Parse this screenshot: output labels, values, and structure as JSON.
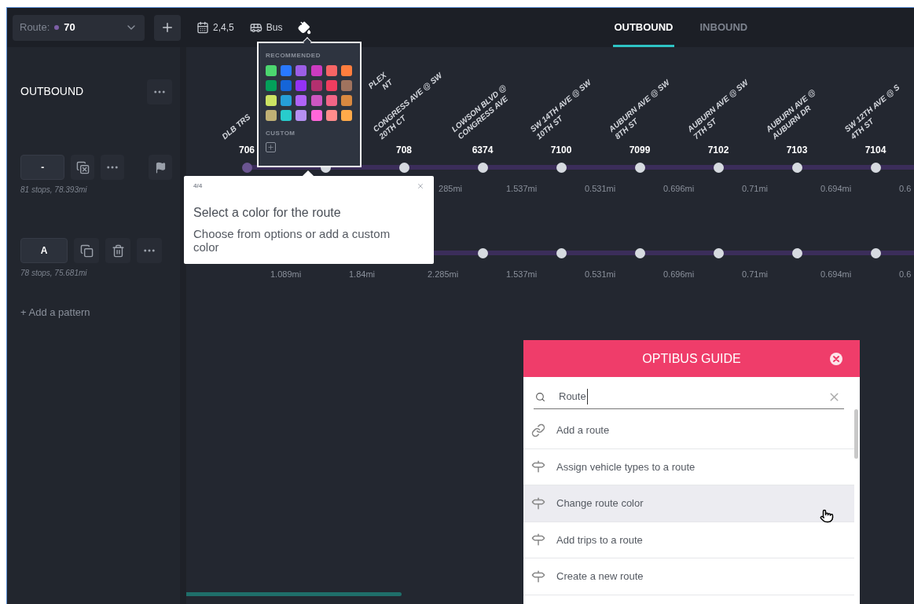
{
  "toolbar": {
    "route_select": {
      "label": "Route:",
      "value": "70",
      "color": "#7d5fa6"
    },
    "days": "2,4,5",
    "vehicle": "Bus"
  },
  "tabs": [
    {
      "label": "OUTBOUND",
      "selected": true
    },
    {
      "label": "INBOUND",
      "selected": false
    }
  ],
  "sidebar": {
    "title": "OUTBOUND",
    "patterns": [
      {
        "name": "-",
        "summary": "81 stops, 78.393mi",
        "kind": "main"
      },
      {
        "name": "A",
        "summary": "78 stops, 75.681mi",
        "kind": "variant"
      }
    ],
    "add_link": "+ Add a pattern"
  },
  "stops": [
    {
      "name_lines": [
        "DLB TRS"
      ],
      "code": "706",
      "kind": "full"
    },
    {
      "name_lines": [
        "PLEX",
        "NT"
      ],
      "kind": "cut"
    },
    {
      "name_lines": [
        "CONGRESS AVE @ SW",
        "20TH CT"
      ],
      "code": "708",
      "kind": "full"
    },
    {
      "name_lines": [
        "LOWSON BLVD @",
        "CONGRESS AVE"
      ],
      "code": "6374",
      "kind": "full"
    },
    {
      "name_lines": [
        "SW 14TH AVE @ SW",
        "10TH ST"
      ],
      "code": "7100",
      "kind": "full"
    },
    {
      "name_lines": [
        "AUBURN AVE @ SW",
        "8TH ST"
      ],
      "code": "7099",
      "kind": "full"
    },
    {
      "name_lines": [
        "AUBURN AVE @ SW",
        "7TH ST"
      ],
      "code": "7102",
      "kind": "full"
    },
    {
      "name_lines": [
        "AUBURN AVE @",
        "AUBURN DR"
      ],
      "code": "7103",
      "kind": "full"
    },
    {
      "name_lines": [
        "SW 12TH AVE @ S",
        "4TH ST"
      ],
      "code": "7104",
      "kind": "full"
    }
  ],
  "pattern_rows": [
    {
      "dots": [
        {
          "kind": "first"
        },
        {
          "kind": "stop"
        },
        {
          "kind": "stop"
        },
        {
          "kind": "stop"
        },
        {
          "kind": "stop"
        },
        {
          "kind": "stop"
        },
        {
          "kind": "stop"
        },
        {
          "kind": "stop"
        },
        {
          "kind": "stop"
        }
      ],
      "segments": [
        {
          "kind": "covered"
        },
        {
          "kind": "covered"
        },
        {
          "kind": "cut",
          "text": "285mi"
        },
        {
          "kind": "full",
          "text": "1.537mi"
        },
        {
          "kind": "full",
          "text": "0.531mi"
        },
        {
          "kind": "full",
          "text": "0.696mi"
        },
        {
          "kind": "full",
          "text": "0.71mi"
        },
        {
          "kind": "full",
          "text": "0.694mi"
        },
        {
          "kind": "full",
          "text": "0.6"
        }
      ]
    },
    {
      "dots": [
        {
          "kind": "covered"
        },
        {
          "kind": "covered"
        },
        {
          "kind": "covered"
        },
        {
          "kind": "stop"
        },
        {
          "kind": "stop"
        },
        {
          "kind": "stop"
        },
        {
          "kind": "stop"
        },
        {
          "kind": "stop"
        },
        {
          "kind": "stop"
        }
      ],
      "segments": [
        {
          "kind": "full",
          "text": "1.089mi"
        },
        {
          "kind": "full",
          "text": "1.84mi"
        },
        {
          "kind": "full",
          "text": "2.285mi"
        },
        {
          "kind": "full",
          "text": "1.537mi"
        },
        {
          "kind": "full",
          "text": "0.531mi"
        },
        {
          "kind": "full",
          "text": "0.696mi"
        },
        {
          "kind": "full",
          "text": "0.71mi"
        },
        {
          "kind": "full",
          "text": "0.694mi"
        },
        {
          "kind": "full",
          "text": "0.6"
        }
      ]
    }
  ],
  "color_popover": {
    "recommended_title": "RECOMMENDED",
    "swatches": [
      {
        "color": "#4cd66f"
      },
      {
        "color": "#2979ff"
      },
      {
        "color": "#9c5ee6"
      },
      {
        "color": "#cc3bc0"
      },
      {
        "color": "#f76565"
      },
      {
        "color": "#ff7e3e"
      },
      {
        "color": "#03a05a"
      },
      {
        "color": "#1565d8"
      },
      {
        "color": "#9432f5"
      },
      {
        "color": "#b3306f"
      },
      {
        "color": "#ef3d5f"
      },
      {
        "color": "#a0735e"
      },
      {
        "color": "#cde363"
      },
      {
        "color": "#269fd9"
      },
      {
        "color": "#b063f7"
      },
      {
        "color": "#cc56c1"
      },
      {
        "color": "#f26587"
      },
      {
        "color": "#d98940"
      },
      {
        "color": "#c0b075"
      },
      {
        "color": "#28cccc"
      },
      {
        "color": "#b590f2"
      },
      {
        "color": "#ff66d9"
      },
      {
        "color": "#ff8c8c"
      },
      {
        "color": "#ffaa4a"
      }
    ],
    "custom_title": "CUSTOM"
  },
  "tour_tooltip": {
    "step": "4/4",
    "title": "Select a color for the route",
    "body": "Choose from options or add a custom color"
  },
  "guide": {
    "title": "OPTIBUS GUIDE",
    "search": {
      "value": "Route"
    },
    "items": [
      {
        "label": "Add a route",
        "kind": "link",
        "selected": false
      },
      {
        "label": "Assign vehicle types to a route",
        "kind": "guide",
        "selected": false
      },
      {
        "label": "Change route color",
        "kind": "guide",
        "selected": true
      },
      {
        "label": "Add trips to a route",
        "kind": "guide",
        "selected": false
      },
      {
        "label": "Create a new route",
        "kind": "guide",
        "selected": false
      }
    ]
  }
}
